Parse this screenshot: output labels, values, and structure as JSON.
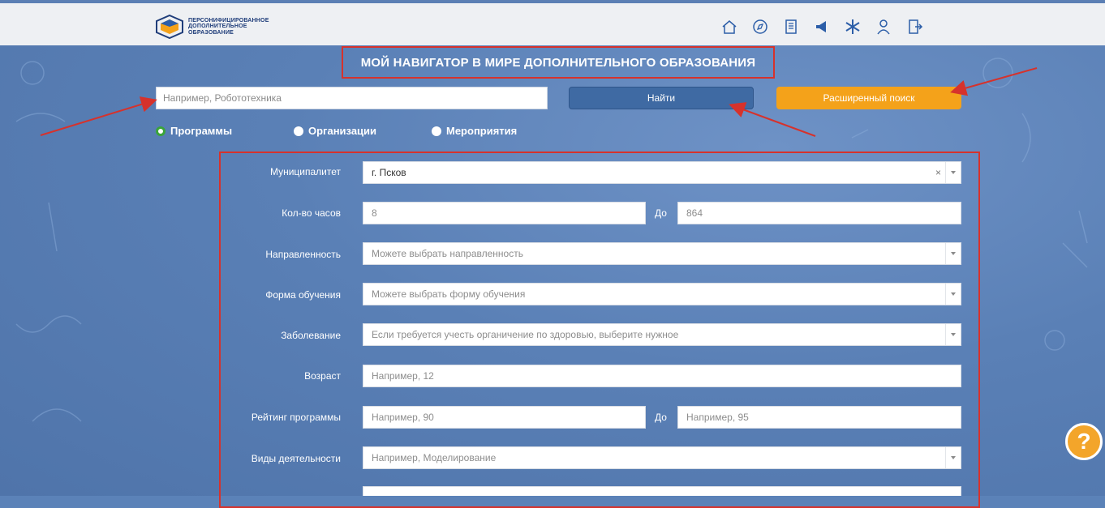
{
  "header": {
    "logo_lines": [
      "ПЕРСОНИФИЦИРОВАННОЕ",
      "ДОПОЛНИТЕЛЬНОЕ",
      "ОБРАЗОВАНИЕ"
    ],
    "nav_icons": [
      "home-icon",
      "compass-icon",
      "document-icon",
      "megaphone-icon",
      "star-icon",
      "user-icon",
      "exit-icon"
    ]
  },
  "title": "МОЙ НАВИГАТОР В МИРЕ ДОПОЛНИТЕЛЬНОГО ОБРАЗОВАНИЯ",
  "search": {
    "placeholder": "Например, Робототехника",
    "find_label": "Найти",
    "advanced_label": "Расширенный поиск"
  },
  "radios": [
    {
      "label": "Программы",
      "selected": true
    },
    {
      "label": "Организации",
      "selected": false
    },
    {
      "label": "Мероприятия",
      "selected": false
    }
  ],
  "form": {
    "municipality": {
      "label": "Муниципалитет",
      "value": "г. Псков",
      "clear": "×"
    },
    "hours": {
      "label": "Кол-во часов",
      "from": "8",
      "to_label": "До",
      "to": "864"
    },
    "direction": {
      "label": "Направленность",
      "placeholder": "Можете выбрать направленность"
    },
    "form_type": {
      "label": "Форма обучения",
      "placeholder": "Можете выбрать форму обучения"
    },
    "disease": {
      "label": "Заболевание",
      "placeholder": "Если требуется учесть органичение по здоровью, выберите нужное"
    },
    "age": {
      "label": "Возраст",
      "placeholder": "Например, 12"
    },
    "rating": {
      "label": "Рейтинг программы",
      "from_placeholder": "Например, 90",
      "to_label": "До",
      "to_placeholder": "Например, 95"
    },
    "activities": {
      "label": "Виды деятельности",
      "placeholder": "Например, Моделирование"
    }
  },
  "help_label": "?",
  "colors": {
    "accent": "#3f6aa3",
    "orange": "#f4a21a",
    "annotation": "#d6322c",
    "selected_radio": "#3aa43a"
  }
}
